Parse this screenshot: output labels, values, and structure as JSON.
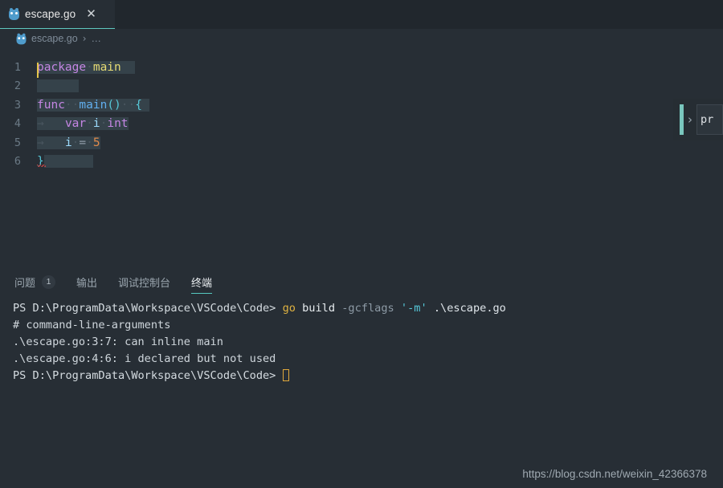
{
  "window": {
    "background_color": "#272e35",
    "accent_color": "#56c8c0"
  },
  "tabbar": {
    "tabs": [
      {
        "label": "escape.go",
        "icon": "go-gopher-icon",
        "active": true,
        "close_glyph": "✕"
      }
    ]
  },
  "breadcrumb": {
    "icon": "go-gopher-icon",
    "file": "escape.go",
    "separator": "›",
    "overflow": "…"
  },
  "editor": {
    "language": "go",
    "lines": [
      {
        "number": "1",
        "cursor": true,
        "tokens": [
          {
            "text": "package",
            "kind": "kw",
            "selected": true
          },
          {
            "text": "·",
            "kind": "dot",
            "selected": true
          },
          {
            "text": "main",
            "kind": "pkg",
            "selected": true
          },
          {
            "text": "  ",
            "kind": "plain",
            "selected": true
          }
        ]
      },
      {
        "number": "2",
        "cursor": false,
        "tokens": [
          {
            "text": "      ",
            "kind": "plain",
            "selected": true
          }
        ]
      },
      {
        "number": "3",
        "cursor": false,
        "tokens": [
          {
            "text": "func",
            "kind": "kw",
            "selected": true
          },
          {
            "text": "··",
            "kind": "dot",
            "selected": true
          },
          {
            "text": "main",
            "kind": "fn",
            "selected": true
          },
          {
            "text": "()",
            "kind": "punct",
            "selected": true
          },
          {
            "text": "··",
            "kind": "dot",
            "selected": true
          },
          {
            "text": "{",
            "kind": "punct",
            "selected": true
          },
          {
            "text": " ",
            "kind": "plain",
            "selected": true
          }
        ]
      },
      {
        "number": "4",
        "cursor": false,
        "tokens": [
          {
            "text": "→",
            "kind": "arrow",
            "selected": true
          },
          {
            "text": "   ",
            "kind": "plain",
            "selected": true
          },
          {
            "text": "var",
            "kind": "kw",
            "selected": true
          },
          {
            "text": "·",
            "kind": "dot",
            "selected": true
          },
          {
            "text": "i",
            "kind": "ident",
            "selected": true
          },
          {
            "text": "·",
            "kind": "dot",
            "selected": true
          },
          {
            "text": "int",
            "kind": "kw",
            "selected": true
          }
        ]
      },
      {
        "number": "5",
        "cursor": false,
        "tokens": [
          {
            "text": "→",
            "kind": "arrow",
            "selected": true
          },
          {
            "text": "   ",
            "kind": "plain",
            "selected": true
          },
          {
            "text": "i",
            "kind": "ident",
            "selected": true
          },
          {
            "text": "·",
            "kind": "dot",
            "selected": true
          },
          {
            "text": "=",
            "kind": "op",
            "selected": true
          },
          {
            "text": "·",
            "kind": "dot",
            "selected": true
          },
          {
            "text": "5",
            "kind": "num",
            "selected": true
          }
        ]
      },
      {
        "number": "6",
        "cursor": false,
        "error_squiggle": true,
        "tokens": [
          {
            "text": "}",
            "kind": "punct",
            "selected": false
          },
          {
            "text": "       ",
            "kind": "plain",
            "selected": true
          }
        ]
      }
    ]
  },
  "overlay": {
    "chevron": "›",
    "text": "pr"
  },
  "panel": {
    "tabs": [
      {
        "label": "问题",
        "badge": "1",
        "active": false
      },
      {
        "label": "输出",
        "badge": null,
        "active": false
      },
      {
        "label": "调试控制台",
        "badge": null,
        "active": false
      },
      {
        "label": "终端",
        "badge": null,
        "active": true
      }
    ]
  },
  "terminal": {
    "lines": [
      {
        "segments": [
          {
            "text": "PS D:\\ProgramData\\Workspace\\VSCode\\Code> ",
            "kind": "prompt"
          },
          {
            "text": "go",
            "kind": "cmd-go"
          },
          {
            "text": " build ",
            "kind": "cmd"
          },
          {
            "text": "-gcflags",
            "kind": "flag"
          },
          {
            "text": " ",
            "kind": "cmd"
          },
          {
            "text": "'-m'",
            "kind": "str"
          },
          {
            "text": " .\\escape.go",
            "kind": "path"
          }
        ]
      },
      {
        "segments": [
          {
            "text": "# command-line-arguments",
            "kind": "err"
          }
        ]
      },
      {
        "segments": [
          {
            "text": ".\\escape.go:3:7: can inline main",
            "kind": "err"
          }
        ]
      },
      {
        "segments": [
          {
            "text": ".\\escape.go:4:6: i declared but not used",
            "kind": "err"
          }
        ]
      },
      {
        "segments": [
          {
            "text": "PS D:\\ProgramData\\Workspace\\VSCode\\Code> ",
            "kind": "prompt"
          }
        ],
        "cursor": true
      }
    ]
  },
  "watermark": {
    "text": "https://blog.csdn.net/weixin_42366378"
  }
}
